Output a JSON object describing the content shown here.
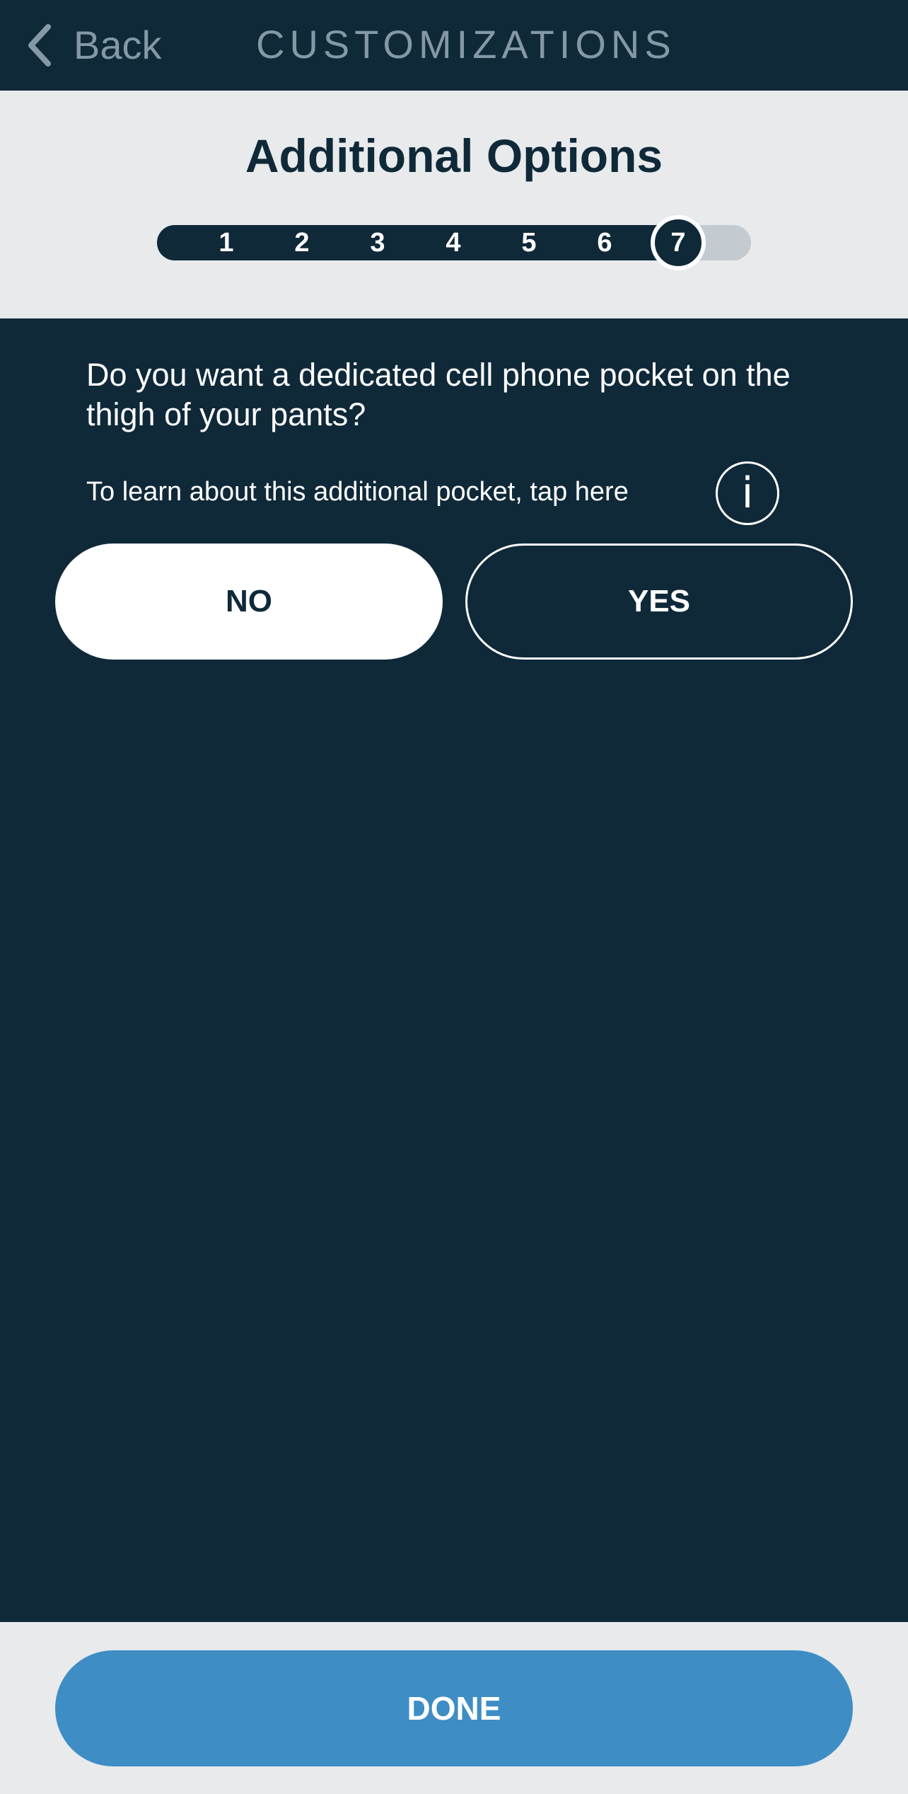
{
  "nav": {
    "back_label": "Back",
    "title": "CUSTOMIZATIONS"
  },
  "header": {
    "title": "Additional Options"
  },
  "stepper": {
    "steps": [
      "1",
      "2",
      "3",
      "4",
      "5",
      "6",
      "7"
    ],
    "current_step": "7"
  },
  "question": {
    "text": "Do you want a dedicated cell phone pocket on the thigh of your pants?",
    "learn_text": "To learn about this additional pocket, tap here",
    "info_icon": "i"
  },
  "choices": {
    "no_label": "NO",
    "yes_label": "YES",
    "selected": "NO"
  },
  "footer": {
    "done_label": "DONE"
  },
  "colors": {
    "background": "#0f2939",
    "panel": "#e8eaec",
    "accent": "#3e8dc5",
    "muted_text": "#8598a6"
  }
}
